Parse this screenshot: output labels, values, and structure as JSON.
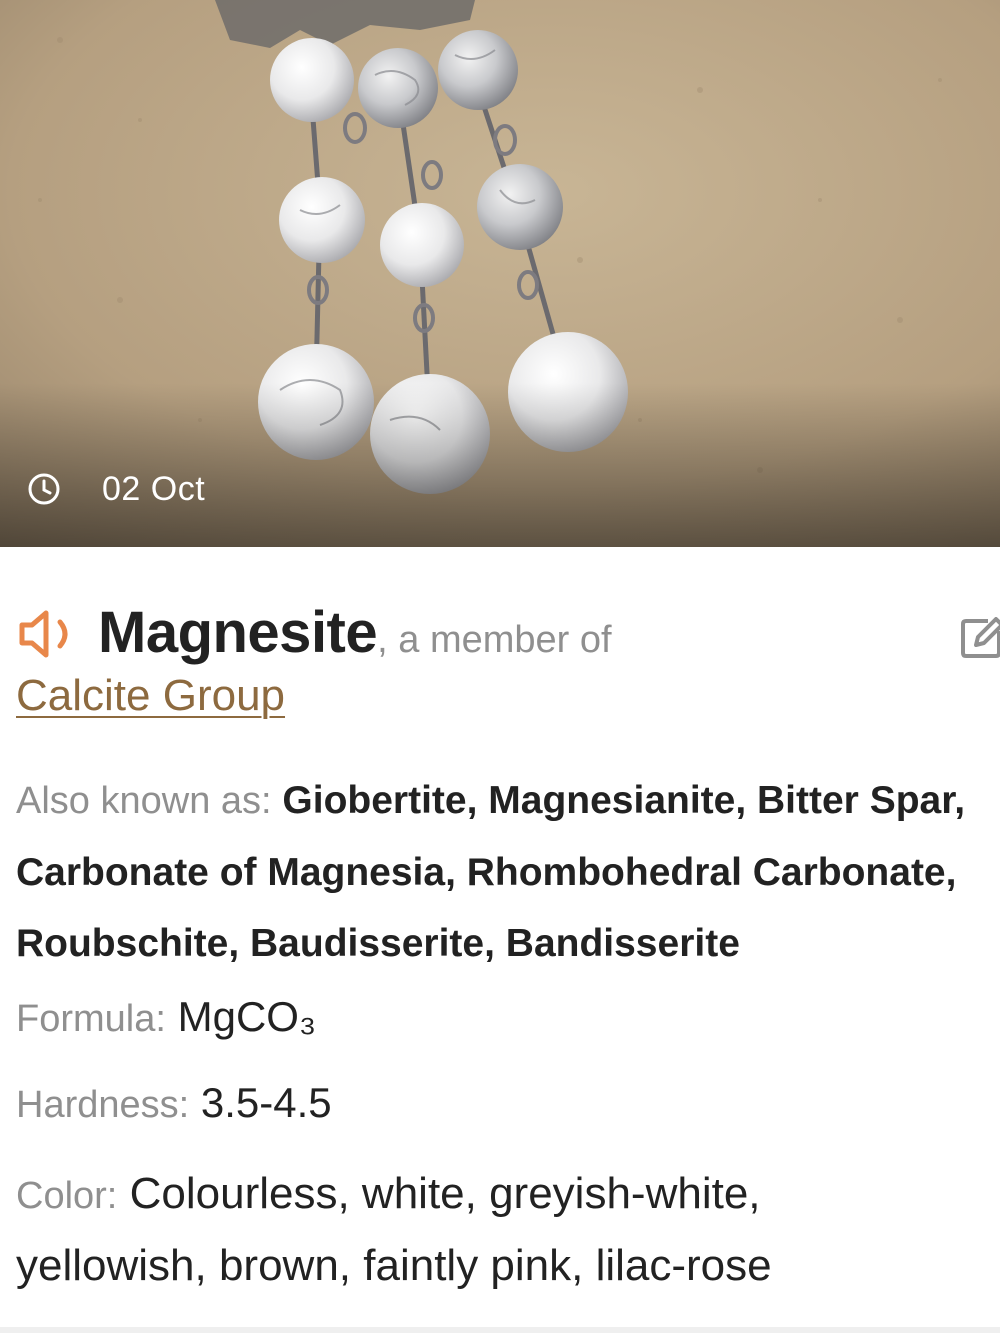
{
  "photo": {
    "alt": "white marbled stone bead pendant",
    "date": "02 Oct",
    "date_icon": "clock-icon"
  },
  "result": {
    "audio_icon": "speaker-icon",
    "name": "Magnesite",
    "member_text": ", a member of",
    "group": "Calcite Group",
    "edit_icon": "edit-icon",
    "aka_label": "Also known as:",
    "aka_value": "Giobertite, Magnesianite, Bitter Spar, Carbonate of Magnesia, Rhombohedral Carbonate, Roubschite, Baudisserite, Bandisserite",
    "formula_label": "Formula:",
    "formula_value": "MgCO₃",
    "hardness_label": "Hardness:",
    "hardness_value": "3.5-4.5",
    "color_label": "Color:",
    "color_value": "Colourless, white, greyish-white, yellowish, brown, faintly pink, lilac-rose"
  },
  "colors": {
    "accent_orange": "#e8874a",
    "link_brown": "#8d6a3f",
    "label_grey": "#8f8f8f",
    "text_dark": "#222222"
  }
}
